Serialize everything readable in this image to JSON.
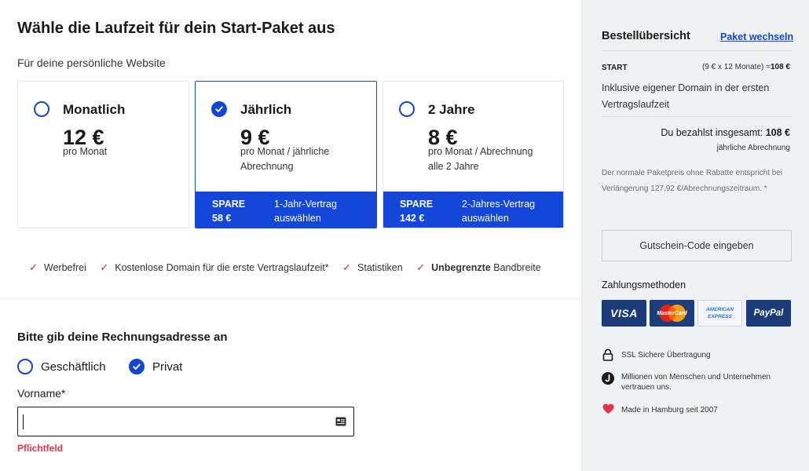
{
  "main": {
    "heading": "Wähle die Laufzeit für dein Start-Paket aus",
    "subheading": "Für deine persönliche Website",
    "plans": [
      {
        "title": "Monatlich",
        "price": "12 €",
        "per": "pro Monat",
        "selected": false,
        "spare_label": "",
        "spare_amount": "",
        "cta_line1": "",
        "cta_line2": ""
      },
      {
        "title": "Jährlich",
        "price": "9 €",
        "per": "pro Monat / jährliche Abrechnung",
        "selected": true,
        "spare_label": "SPARE",
        "spare_amount": "58 €",
        "cta_line1": "1-Jahr-Vertrag",
        "cta_line2": "auswählen"
      },
      {
        "title": "2 Jahre",
        "price": "8 €",
        "per": "pro Monat / Abrechnung alle 2 Jahre",
        "selected": false,
        "spare_label": "SPARE",
        "spare_amount": "142 €",
        "cta_line1": "2-Jahres-Vertrag",
        "cta_line2": "auswählen"
      }
    ],
    "features": [
      {
        "bold": "",
        "text": "Werbefrei"
      },
      {
        "bold": "",
        "text": "Kostenlose Domain für die erste Vertragslaufzeit*"
      },
      {
        "bold": "",
        "text": "Statistiken"
      },
      {
        "bold": "Unbegrenzte",
        "text": " Bandbreite"
      }
    ],
    "billing": {
      "heading": "Bitte gib deine Rechnungsadresse an",
      "options": [
        {
          "label": "Geschäftlich",
          "checked": false
        },
        {
          "label": "Privat",
          "checked": true
        }
      ],
      "firstname_label": "Vorname*",
      "firstname_value": "",
      "error": "Pflichtfeld"
    }
  },
  "sidebar": {
    "title": "Bestellübersicht",
    "change_link": "Paket wechseln",
    "package_name": "START",
    "calc_prefix": "(9 € x 12 Monate) =",
    "calc_total": "108 €",
    "included": "Inklusive eigener Domain in der ersten Vertragslaufzeit",
    "total_prefix": "Du bezahlst insgesamt: ",
    "total_value": "108 €",
    "billing_period": "jährliche Abrechnung",
    "note": "Der normale Paketpreis ohne Rabatte entspricht bei Verlängerung 127,92 €/Abrechnungszeitraum. *",
    "coupon_button": "Gutschein-Code eingeben",
    "payment_title": "Zahlungsmethoden",
    "payment_methods": {
      "visa": "VISA",
      "mastercard": "MasterCard",
      "amex_line1": "AMERICAN",
      "amex_line2": "EXPRESS",
      "paypal": "PayPal"
    },
    "trust": [
      {
        "icon": "lock-icon",
        "text": "SSL Sichere Übertragung"
      },
      {
        "icon": "brand-logo-icon",
        "text": "Millionen von Menschen und Unternehmen vertrauen uns."
      },
      {
        "icon": "heart-icon",
        "text": "Made in Hamburg seit 2007"
      }
    ],
    "colors": {
      "accent": "#1346d7",
      "error": "#e5334b",
      "check": "#d81b60",
      "sidebar_bg": "#eff1f3"
    }
  }
}
